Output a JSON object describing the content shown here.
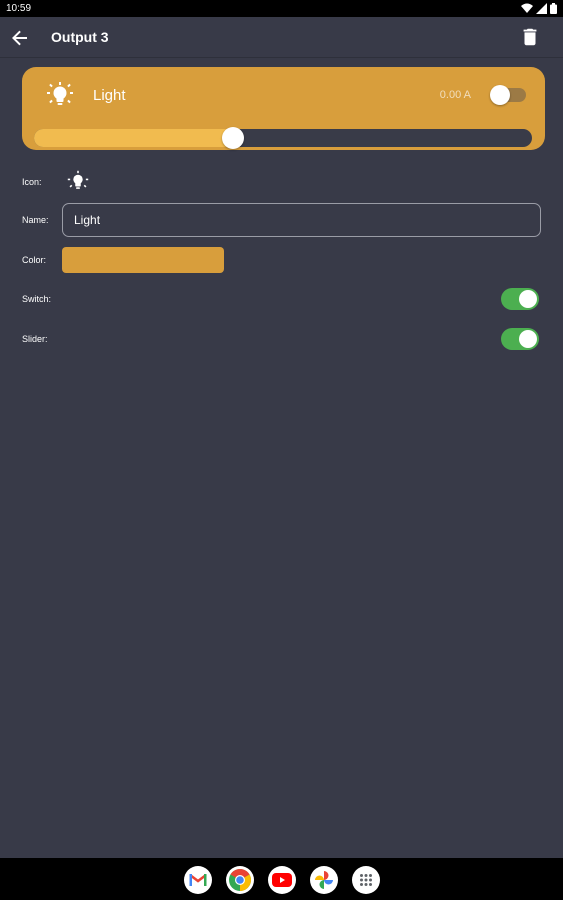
{
  "status_bar": {
    "time": "10:59",
    "icons": [
      "wifi-icon",
      "signal-icon",
      "battery-icon"
    ]
  },
  "app_bar": {
    "title": "Output 3",
    "back_icon": "arrow-left-icon",
    "delete_icon": "trash-icon"
  },
  "output_card": {
    "name": "Light",
    "current": "0.00 A",
    "icon": "light-bulb-icon",
    "toggle_on": false,
    "slider_level_percent": 40,
    "colors": {
      "card": "#d89e3c",
      "slider_fill": "#f1bb4f",
      "slider_track": "#393b48"
    }
  },
  "form": {
    "icon_label": "Icon:",
    "icon_value": "light-bulb-icon",
    "name_label": "Name:",
    "name_value": "Light",
    "color_label": "Color:",
    "color_value": "#d89e3c",
    "switch_label": "Switch:",
    "switch_on": true,
    "slider_label": "Slider:",
    "slider_on": true,
    "toggle_on_color": "#4caf50"
  },
  "dock": {
    "apps": [
      "gmail-icon",
      "chrome-icon",
      "youtube-icon",
      "photos-icon",
      "app-drawer-icon"
    ]
  }
}
